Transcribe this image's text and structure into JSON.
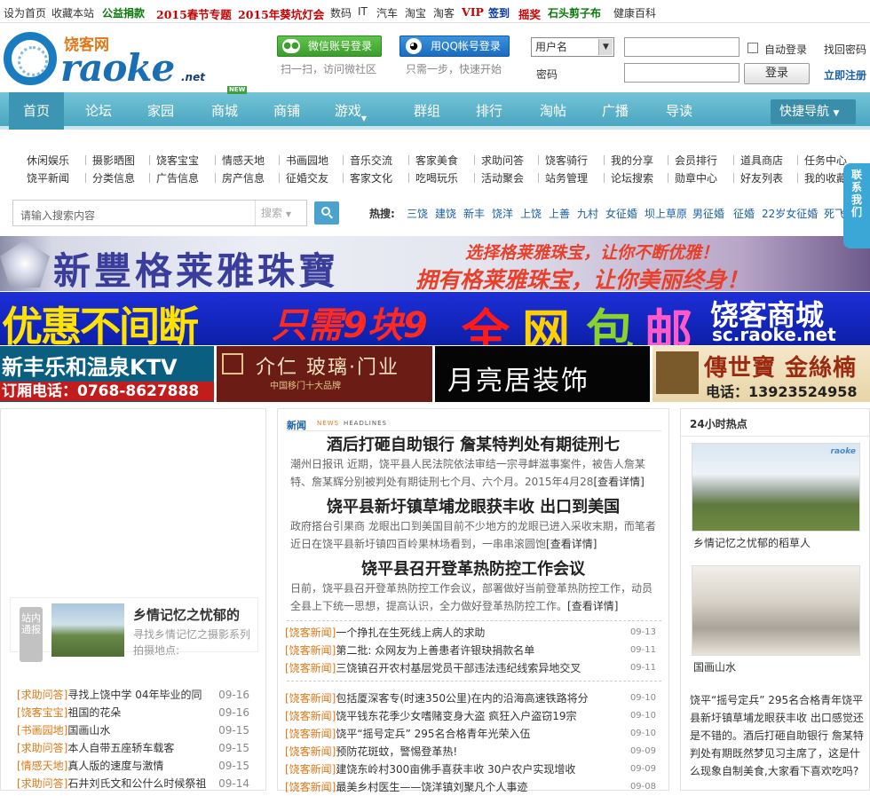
{
  "topbar": {
    "links": [
      "设为首页",
      "收藏本站",
      "公益捐款",
      "2015春节专题",
      "2015年葵坑灯会",
      "数码",
      "IT",
      "汽车",
      "淘宝",
      "淘客",
      "VIP",
      "签到",
      "摇奖",
      "石头剪子布",
      "健康百科"
    ]
  },
  "logo": {
    "cn": "饶客网",
    "en": "raoke",
    "suffix": ".net"
  },
  "header": {
    "wechat_login": "微信账号登录",
    "wechat_hint": "扫一扫，访问微社区",
    "qq_login": "用QQ帐号登录",
    "qq_hint": "只需一步，快速开始",
    "wechat_icon": "wechat-icon",
    "qq_icon": "qq-penguin-icon"
  },
  "login": {
    "select_value": "用户名",
    "password_label": "密码",
    "auto_login": "自动登录",
    "find_password": "找回密码",
    "submit": "登录",
    "register": "立即注册"
  },
  "nav": {
    "items": [
      "首页",
      "论坛",
      "家园",
      "商城",
      "商铺",
      "游戏",
      "群组",
      "排行",
      "淘帖",
      "广播",
      "导读"
    ],
    "new_badge": "NEW",
    "quick": "快捷导航",
    "active_color": "#3c95b2"
  },
  "sub": {
    "row1": [
      "休闲娱乐",
      "摄影晒图",
      "饶客宝宝",
      "情感天地",
      "书画园地",
      "音乐交流",
      "客家美食",
      "求助问答",
      "饶客骑行",
      "我的分享",
      "会员排行",
      "道具商店",
      "任务中心"
    ],
    "row2": [
      "饶平新闻",
      "分类信息",
      "广告信息",
      "房产信息",
      "征婚交友",
      "客家文化",
      "吃喝玩乐",
      "活动聚会",
      "站务管理",
      "论坛搜索",
      "勋章中心",
      "好友列表",
      "我的收藏"
    ]
  },
  "search": {
    "placeholder": "请输入搜索内容",
    "type": "搜索",
    "hot_label": "热搜:",
    "hot": [
      "三饶",
      "建饶",
      "新丰",
      "饶洋",
      "上饶",
      "上善",
      "九村",
      "女征婚",
      "坝上草原",
      "男征婚",
      "征婚",
      "22岁女征婚",
      "死飞"
    ]
  },
  "banners": {
    "b1_main": "新豐格莱雅珠寶",
    "b1_top": "选择格莱雅珠宝，让你不断优雅！",
    "b1_bottom": "拥有格莱雅珠宝，让你美丽终身！",
    "b2_a": "优惠不间断",
    "b2_b": "只需9块9",
    "b2_c": [
      "全",
      "网",
      "包",
      "邮"
    ],
    "b2_d": "饶客商城",
    "b2_e": "sc.raoke.net",
    "b3_a": "新丰乐和温泉KTV",
    "b3_b": "订厢电话：0768-8627888",
    "b4_a": "介仁 玻璃·门业",
    "b4_b": "中国移门十大品牌",
    "b5_a": "月亮居装饰",
    "b6_a": "傳世寶 金絲楠",
    "b6_b": "电话：13923524958"
  },
  "left": {
    "tag": "站内通报",
    "feature_title": "乡情记忆之忧郁的",
    "feature_desc": "寻找乡情记忆之摄影系列拍摄地点:",
    "rows": [
      {
        "cat": "[求助问答]",
        "title": "寻找上饶中学 04年毕业的同",
        "date": "09-16"
      },
      {
        "cat": "[饶客宝宝]",
        "title": "祖国的花朵",
        "date": "09-16"
      },
      {
        "cat": "[书画园地]",
        "title": "国画山水",
        "date": "09-15"
      },
      {
        "cat": "[求助问答]",
        "title": "本人自带五座轿车载客",
        "date": "09-15"
      },
      {
        "cat": "[情感天地]",
        "title": "真人版的速度与激情",
        "date": "09-15"
      },
      {
        "cat": "[求助问答]",
        "title": "石井刘氏文和公什么时候祭祖",
        "date": "09-14"
      }
    ]
  },
  "center": {
    "header_cn": "新闻",
    "header_en1": "NEWS",
    "header_en2": "HEADLINES",
    "headline1": "酒后打砸自助银行  詹某特判处有期徒刑七",
    "text1": "潮州日报讯 近期，饶平县人民法院依法审结一宗寻衅滋事案件，被告人詹某特、詹某辉分别被判处有期徒刑七个月、六个月。2015年4月28",
    "more1": "[查看详情]",
    "headline2": "饶平县新圩镇草埔龙眼获丰收  出口到美国",
    "text2": "政府搭台引果商 龙眼出口到美国目前不少地方的龙眼已进入采收末期，而笔者近日在饶平县新圩镇四百岭果林场看到，一串串滚圆饱",
    "more2": "[查看详情]",
    "headline3": "饶平县召开登革热防控工作会议",
    "text3": "日前，饶平县召开登革热防控工作会议，部署做好当前登革热防控工作，动员全县上下统一思想，提高认识，全力做好登革热防控工作。",
    "more3": "[查看详情]",
    "list1": [
      {
        "cat": "[饶客新闻]",
        "title": "一个挣扎在生死线上病人的求助",
        "date": "09-13"
      },
      {
        "cat": "[饶客新闻]",
        "title": "第二批: 众网友为上善患者许银玦捐款名单",
        "date": "09-11"
      },
      {
        "cat": "[饶客新闻]",
        "title": "三饶镇召开农村基层党员干部违法违纪线索异地交叉",
        "date": "09-11"
      }
    ],
    "list2": [
      {
        "cat": "[饶客新闻]",
        "title": "包括厦深客专(时速350公里)在内的沿海高速铁路将分",
        "date": "09-10"
      },
      {
        "cat": "[饶客新闻]",
        "title": "饶平钱东花季少女嗜赌变身大盗  疯狂入户盗窃19宗",
        "date": "09-10"
      },
      {
        "cat": "[饶客新闻]",
        "title": "饶平“摇号定兵” 295名合格青年光荣入伍",
        "date": "09-10"
      },
      {
        "cat": "[饶客新闻]",
        "title": "预防花斑蚊，警惕登革热!",
        "date": "09-09"
      },
      {
        "cat": "[饶客新闻]",
        "title": "建饶东岭村300亩佛手喜获丰收  30户农户实现增收",
        "date": "09-09"
      },
      {
        "cat": "[饶客新闻]",
        "title": "最美乡村医生——饶洋镇刘聚凡个人事迹",
        "date": "09-08"
      }
    ]
  },
  "right": {
    "title": "24小时热点",
    "cap1": "乡情记忆之忧郁的稻草人",
    "cap2": "国画山水",
    "photo_watermark": "raoke",
    "text": "饶平“摇号定兵” 295名合格青年饶平县新圩镇草埔龙眼获丰收 出口感觉还是不错的。酒后打砸自助银行 詹某特判处有期既然梦见习主席了，这是什么现象自制美食,大家看下喜欢吃吗?"
  },
  "side": {
    "label": "联系我们"
  }
}
